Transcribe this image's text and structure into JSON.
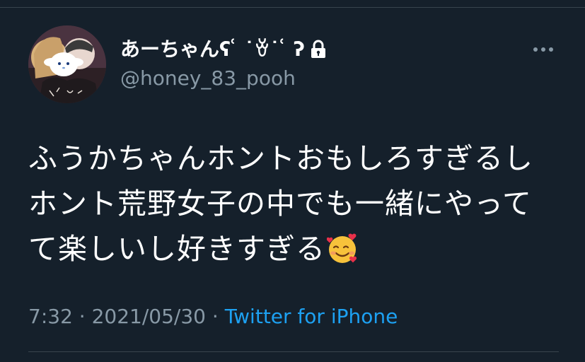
{
  "user": {
    "display_name": "あーちゃんʕ ͑ ˙ꈊ˙ ͑ ʔ",
    "handle": "@honey_83_pooh",
    "protected_icon": "lock-icon",
    "avatar_icon": "profile-photo"
  },
  "menu": {
    "icon": "more-horizontal-icon"
  },
  "tweet": {
    "lines": [
      "ふうかちゃんホントおもしろすぎるし",
      "ホント荒野女子の中でも一緒にやって",
      "て楽しいし好きすぎる"
    ],
    "emoji": "smiling-face-with-hearts"
  },
  "meta": {
    "time": "7:32",
    "separator1": " · ",
    "date": "2021/05/30",
    "separator2": " · ",
    "source": "Twitter for iPhone"
  },
  "colors": {
    "background": "#15202b",
    "text": "#ffffff",
    "secondary": "#8899a6",
    "link": "#1da1f2",
    "divider": "#38444d"
  }
}
